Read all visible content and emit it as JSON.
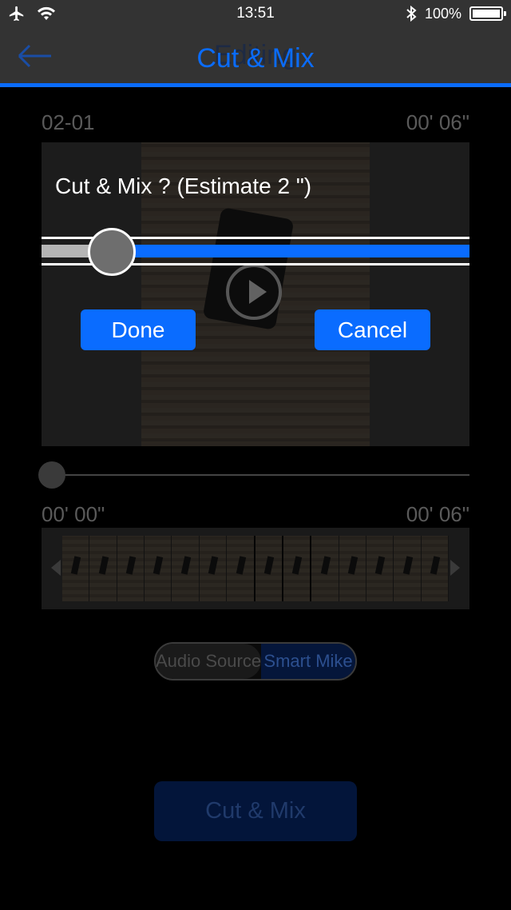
{
  "status_bar": {
    "time": "13:51",
    "battery_percent": "100%",
    "icons": [
      "airplane-icon",
      "wifi-icon",
      "bluetooth-icon",
      "battery-icon"
    ]
  },
  "nav": {
    "ghost_title": "Editing",
    "title": "Cut & Mix",
    "back_icon": "back-arrow-icon"
  },
  "clip": {
    "id": "02-01",
    "duration": "00' 06\""
  },
  "dialog": {
    "title": "Cut & Mix ? (Estimate 2 \")",
    "done_label": "Done",
    "cancel_label": "Cancel",
    "slider_position": 0.17
  },
  "playback": {
    "position": 0,
    "start_time": "00' 00\"",
    "end_time": "00' 06\""
  },
  "audio_toggle": {
    "options": [
      "Audio Source",
      "Smart Mike"
    ],
    "selected": "Smart Mike"
  },
  "action": {
    "cut_mix_label": "Cut & Mix"
  },
  "colors": {
    "accent": "#0a6cff",
    "bar_background": "#333333"
  }
}
